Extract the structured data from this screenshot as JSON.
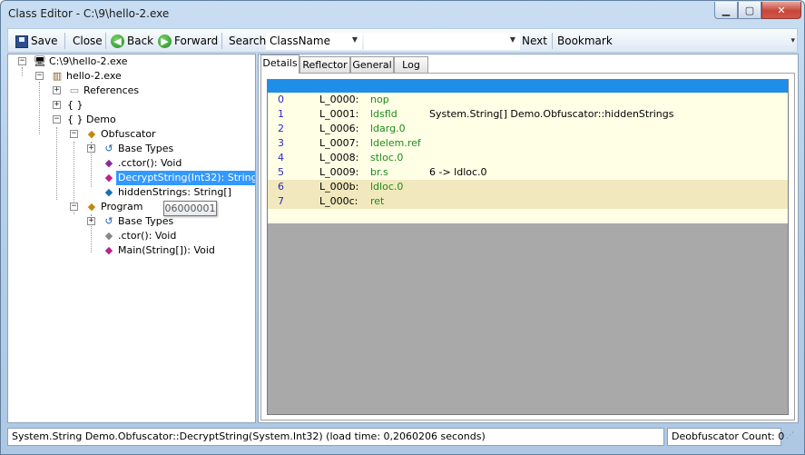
{
  "window": {
    "title": "Class Editor - C:\\9\\hello-2.exe",
    "min_label": "▁",
    "max_label": "▢",
    "close_label": "✕"
  },
  "toolbar": {
    "save_label": "Save",
    "close_label": "Close",
    "back_label": "Back",
    "forward_label": "Forward",
    "search_label": "Search",
    "search_type_value": "ClassName",
    "search_text_value": "",
    "next_label": "Next",
    "bookmark_label": "Bookmark"
  },
  "tree": {
    "root": "C:\\9\\hello-2.exe",
    "assembly": "hello-2.exe",
    "references": "References",
    "empty_namespace": "{ }",
    "demo_namespace": "{ } Demo",
    "obfuscator": "Obfuscator",
    "obf_base_types": "Base Types",
    "obf_ctor": ".cctor(): Void",
    "obf_decrypt": "DecryptString(Int32): String",
    "obf_hidden": "hiddenStrings: String[]",
    "program": "Program",
    "prog_base_types": "Base Types",
    "prog_ctor": ".ctor(): Void",
    "prog_main": "Main(String[]): Void",
    "tooltip": "06000001"
  },
  "tabs": [
    {
      "label": "Details",
      "active": true
    },
    {
      "label": "Reflector",
      "active": false
    },
    {
      "label": "General",
      "active": false
    },
    {
      "label": "Log",
      "active": false
    }
  ],
  "il_rows": [
    {
      "index": "0",
      "label": "L_0000:",
      "opcode": "nop",
      "operand": "",
      "highlighted": false
    },
    {
      "index": "1",
      "label": "L_0001:",
      "opcode": "ldsfld",
      "operand": "System.String[] Demo.Obfuscator::hiddenStrings",
      "highlighted": false
    },
    {
      "index": "2",
      "label": "L_0006:",
      "opcode": "ldarg.0",
      "operand": "",
      "highlighted": false
    },
    {
      "index": "3",
      "label": "L_0007:",
      "opcode": "ldelem.ref",
      "operand": "",
      "highlighted": false
    },
    {
      "index": "4",
      "label": "L_0008:",
      "opcode": "stloc.0",
      "operand": "",
      "highlighted": false
    },
    {
      "index": "5",
      "label": "L_0009:",
      "opcode": "br.s",
      "operand": "6 -> ldloc.0",
      "highlighted": false
    },
    {
      "index": "6",
      "label": "L_000b:",
      "opcode": "ldloc.0",
      "operand": "",
      "highlighted": true
    },
    {
      "index": "7",
      "label": "L_000c:",
      "opcode": "ret",
      "operand": "",
      "highlighted": true
    }
  ],
  "status": {
    "main": "System.String Demo.Obfuscator::DecryptString(System.Int32) (load time: 0,2060206 seconds)",
    "count": "Deobfuscator Count: 0"
  },
  "colors": {
    "selection": "#3399ff",
    "il_header": "#1e8ee8",
    "il_background": "#ffffe6",
    "il_highlight": "#f1e9bd",
    "opcode": "#1e8a1e",
    "index": "#2a2ac8"
  },
  "icons": {
    "save": "floppy-disk-icon",
    "back": "green-back-arrow-icon",
    "forward": "green-forward-arrow-icon",
    "class": "class-icon",
    "method": "method-icon",
    "field": "field-icon"
  }
}
